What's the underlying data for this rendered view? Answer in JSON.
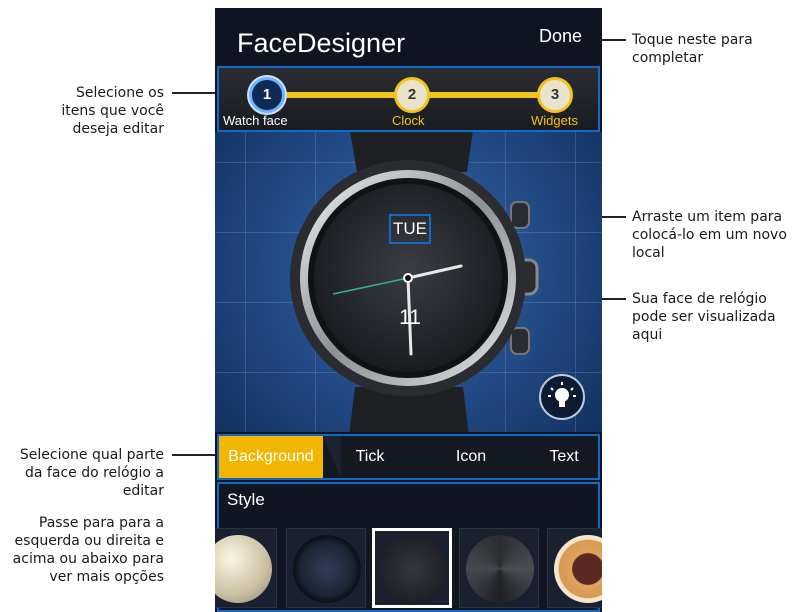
{
  "annotations": {
    "done_note": [
      "Toque neste para",
      "completar"
    ],
    "select_items_note": [
      "Selecione os",
      "itens que você",
      "deseja editar"
    ],
    "drag_note": [
      "Arraste um item para",
      "colocá-lo em um novo",
      "local"
    ],
    "preview_note": [
      "Sua face de relógio",
      "pode ser visualizada",
      "aqui"
    ],
    "select_part_note": [
      "Selecione qual parte",
      "da face do relógio a",
      "editar"
    ],
    "swipe_note": [
      "Passe para para a",
      "esquerda ou direita e",
      "acima ou abaixo para",
      "ver mais opções"
    ]
  },
  "app": {
    "title": "FaceDesigner",
    "done_label": "Done"
  },
  "steps": [
    {
      "number": "1",
      "label": "Watch face",
      "active": true
    },
    {
      "number": "2",
      "label": "Clock",
      "active": false
    },
    {
      "number": "3",
      "label": "Widgets",
      "active": false
    }
  ],
  "watch": {
    "day_label": "TUE",
    "date_label": "11"
  },
  "tabs": [
    {
      "label": "Background",
      "active": true
    },
    {
      "label": "Tick",
      "active": false
    },
    {
      "label": "Icon",
      "active": false
    },
    {
      "label": "Text",
      "active": false
    }
  ],
  "style_panel": {
    "title": "Style",
    "selected_index": 2
  },
  "colors": {
    "accent_blue": "#1468c6",
    "accent_yellow": "#f2c21d",
    "active_tab": "#f2b500"
  }
}
